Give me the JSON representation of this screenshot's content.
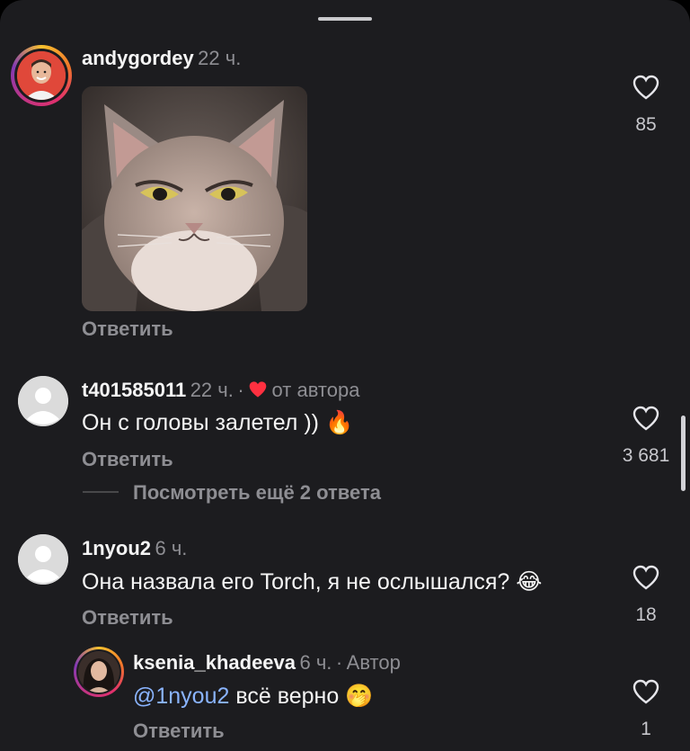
{
  "comments": [
    {
      "username": "andygordey",
      "time": "22 ч.",
      "has_image": true,
      "reply_label": "Ответить",
      "likes": "85"
    },
    {
      "username": "t401585011",
      "time": "22 ч.",
      "separator": "·",
      "author_liked_label": "от автора",
      "text": "Он с головы залетел ))",
      "emoji": "🔥",
      "reply_label": "Ответить",
      "likes": "3 681",
      "view_more": "Посмотреть ещё 2 ответа"
    },
    {
      "username": "1nyou2",
      "time": "6 ч.",
      "text": "Она назвала его Torch, я не ослышался?",
      "emoji": "😂",
      "reply_label": "Ответить",
      "likes": "18",
      "reply": {
        "username": "ksenia_khadeeva",
        "time": "6 ч.",
        "separator": "·",
        "role": "Автор",
        "mention": "@1nyou2",
        "text": "всё верно",
        "emoji": "🤭",
        "reply_label": "Ответить",
        "likes": "1"
      }
    }
  ],
  "colors": {
    "background": "#1c1c1f",
    "text": "#f5f5f5",
    "muted": "#8e8e93",
    "mention": "#8ab4ff",
    "heart_red": "#ff3040"
  }
}
